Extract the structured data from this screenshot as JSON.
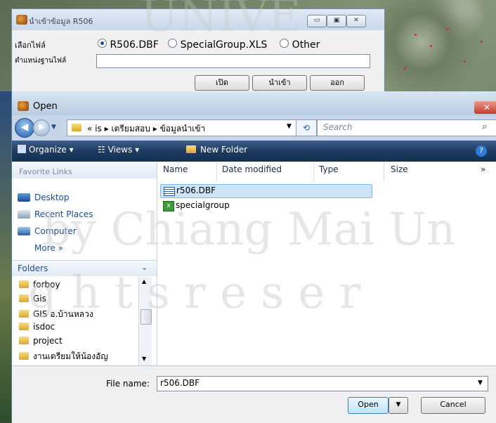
{
  "import_dialog": {
    "title": "นำเข้าข้อมูล R506",
    "caption_buttons": [
      "▭",
      "▣",
      "✕"
    ],
    "select_file_label": "เลือกไฟล์",
    "options": [
      {
        "label": "R506.DBF",
        "selected": true
      },
      {
        "label": "SpecialGroup.XLS",
        "selected": false
      },
      {
        "label": "Other",
        "selected": false
      }
    ],
    "file_location_label": "ตำแหน่งฐานไฟล์",
    "file_location_value": "",
    "buttons": {
      "open": "เปิด",
      "import": "นำเข้า",
      "exit": "ออก"
    }
  },
  "open_dialog": {
    "title": "Open",
    "close_label": "✕",
    "address": {
      "prefix": "«",
      "crumbs": [
        "is",
        "เตรียมสอบ",
        "ข้อมูลนำเข้า"
      ],
      "separator": "▸"
    },
    "search_placeholder": "Search",
    "toolbar": {
      "organize": "Organize",
      "views": "Views",
      "new_folder": "New Folder",
      "help": "?"
    },
    "favorite_links_header": "Favorite Links",
    "favorite_links": [
      {
        "label": "Desktop",
        "icon": "desktop-icon"
      },
      {
        "label": "Recent Places",
        "icon": "recent-places-icon"
      },
      {
        "label": "Computer",
        "icon": "computer-icon"
      }
    ],
    "more_label": "More »",
    "folders_header": "Folders",
    "folders": [
      "forboy",
      "Gis",
      "GIS อ.บ้านหลวง",
      "isdoc",
      "project",
      "งานเตรียมให้น้องอัญ"
    ],
    "columns": [
      "Name",
      "Date modified",
      "Type",
      "Size",
      "»"
    ],
    "files": [
      {
        "name": "r506.DBF",
        "icon": "dbf-file-icon",
        "selected": true
      },
      {
        "name": "specialgroup",
        "icon": "excel-file-icon",
        "selected": false
      }
    ],
    "file_name_label": "File name:",
    "file_name_value": "r506.DBF",
    "open_button": "Open",
    "cancel_button": "Cancel"
  },
  "watermark": {
    "line1": "by Chiang Mai Un",
    "line2": "g h t s   r e s e r",
    "line3": "UNIVE"
  },
  "colors": {
    "toolbar": "#1e3a60",
    "link": "#1a4a9a",
    "selection": "#cce4f7",
    "close": "#c43b2a"
  }
}
